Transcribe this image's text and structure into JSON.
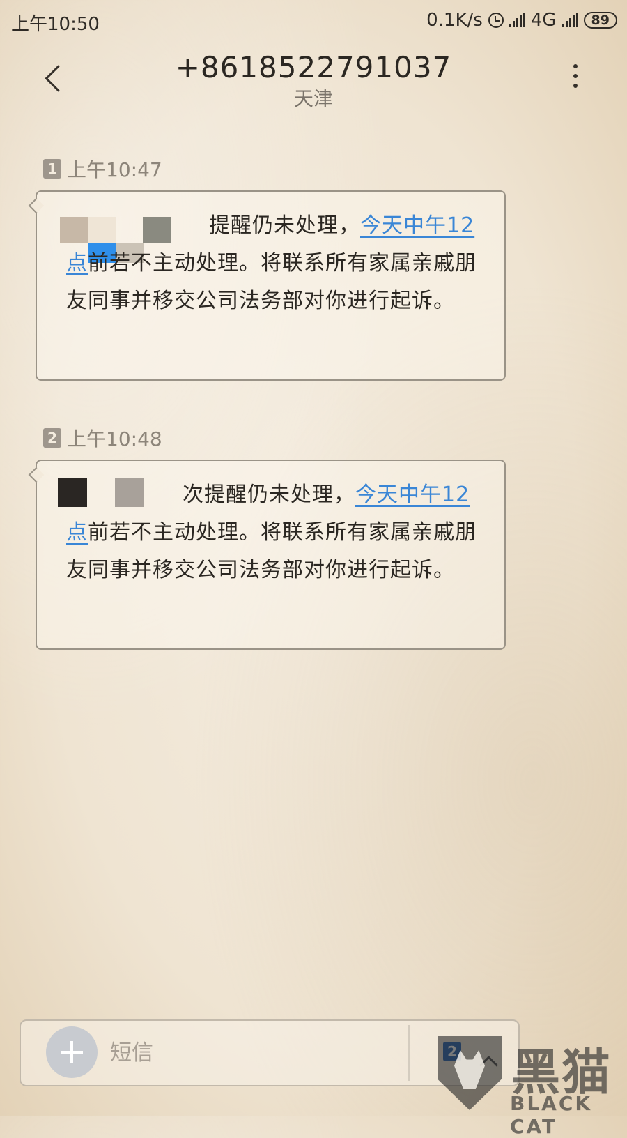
{
  "status_bar": {
    "time": "上午10:50",
    "network_speed": "0.1K/s",
    "network_type": "4G",
    "battery": "89"
  },
  "header": {
    "phone_number": "+8618522791037",
    "location": "天津"
  },
  "messages": [
    {
      "sim": "1",
      "time": "上午10:47",
      "text_start": "提醒仍未处理，",
      "link_text": "今天中午12点",
      "text_end": "前若不主动处理。将联系所有家属亲戚朋友同事并移交公司法务部对你进行起诉。"
    },
    {
      "sim": "2",
      "time": "上午10:48",
      "text_start": "次提醒仍未处理，",
      "link_text": "今天中午12点",
      "text_end": "前若不主动处理。将联系所有家属亲戚朋友同事并移交公司法务部对你进行起诉。"
    }
  ],
  "composer": {
    "placeholder": "短信",
    "send_sim": "2"
  },
  "watermark": {
    "cn": "黑猫",
    "en": "BLACK CAT"
  },
  "icons": {
    "back": "chevron-left-icon",
    "more": "more-vertical-icon",
    "add": "plus-icon",
    "alarm": "alarm-clock-icon",
    "signal": "signal-icon",
    "battery": "battery-icon"
  },
  "colors": {
    "link": "#3a86d6",
    "sim_badge": "#9e968c",
    "send_sim_badge": "#2462b4",
    "add_button": "#c8cbd0"
  }
}
